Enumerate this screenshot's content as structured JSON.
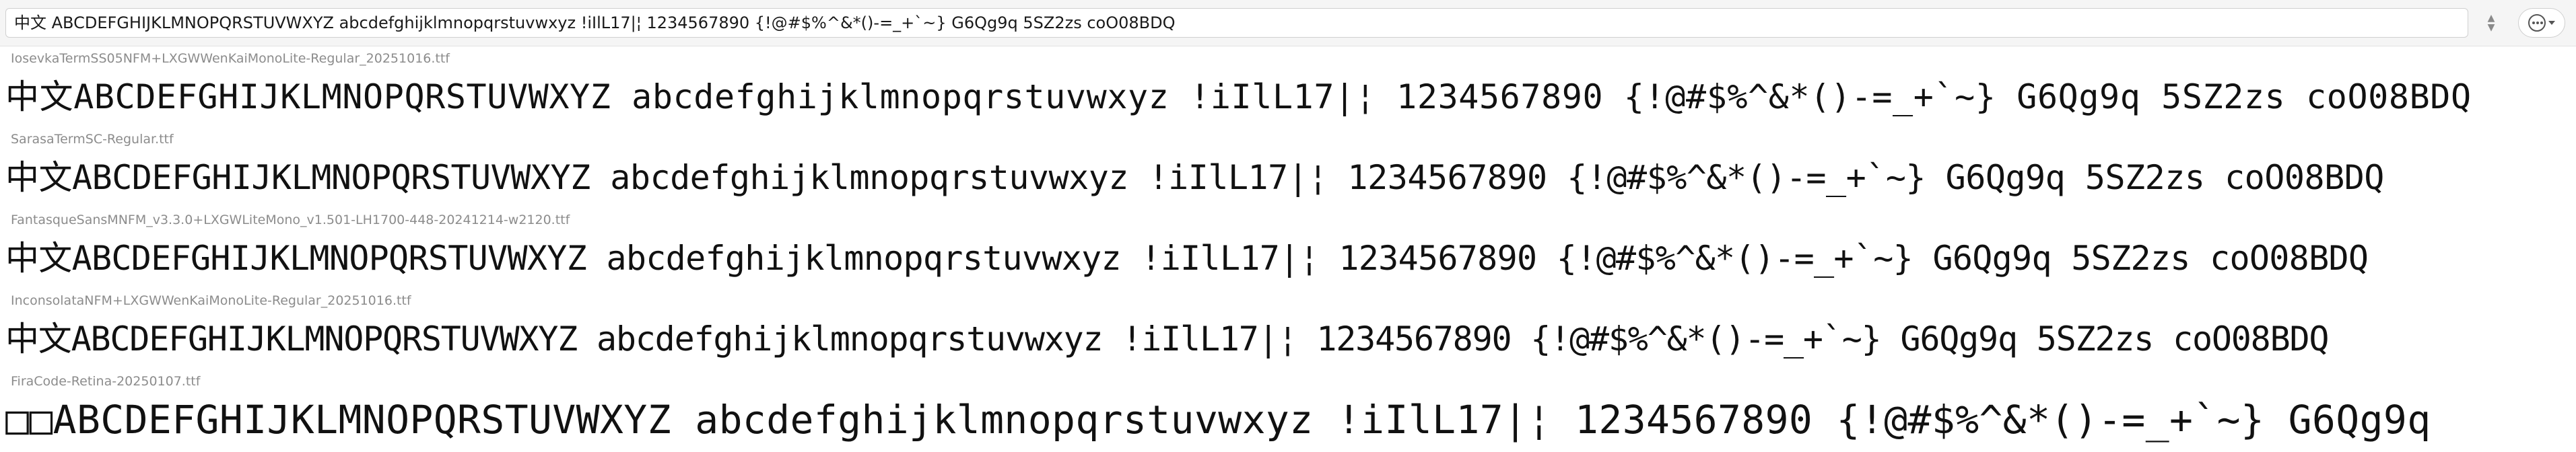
{
  "toolbar": {
    "sample_text": "中文 ABCDEFGHIJKLMNOPQRSTUVWXYZ abcdefghijklmnopqrstuvwxyz !iIlL17|¦ 1234567890 {!@#$%^&*()-=_+`~} G6Qg9q 5SZ2zs coO08BDQ",
    "stepper_up_icon": "chevron-up-icon",
    "stepper_down_icon": "chevron-down-icon",
    "more_icon": "ellipsis-circle-icon"
  },
  "fonts": [
    {
      "name": "IosevkaTermSS05NFM+LXGWWenKaiMonoLite-Regular_20251016.ttf",
      "preview": "中文ABCDEFGHIJKLMNOPQRSTUVWXYZ abcdefghijklmnopqrstuvwxyz !iIlL17|¦ 1234567890 {!@#$%^&*()-=_+`~} G6Qg9q 5SZ2zs coO08BDQ"
    },
    {
      "name": "SarasaTermSC-Regular.ttf",
      "preview": "中文ABCDEFGHIJKLMNOPQRSTUVWXYZ abcdefghijklmnopqrstuvwxyz !iIlL17|¦ 1234567890 {!@#$%^&*()-=_+`~} G6Qg9q 5SZ2zs coO08BDQ"
    },
    {
      "name": "FantasqueSansMNFM_v3.3.0+LXGWLiteMono_v1.501-LH1700-448-20241214-w2120.ttf",
      "preview": "中文ABCDEFGHIJKLMNOPQRSTUVWXYZ abcdefghijklmnopqrstuvwxyz !iIlL17|¦ 1234567890 {!@#$%^&*()-=_+`~} G6Qg9q 5SZ2zs coO08BDQ"
    },
    {
      "name": "InconsolataNFM+LXGWWenKaiMonoLite-Regular_20251016.ttf",
      "preview": "中文ABCDEFGHIJKLMNOPQRSTUVWXYZ abcdefghijklmnopqrstuvwxyz !iIlL17|¦ 1234567890 {!@#$%^&*()-=_+`~} G6Qg9q 5SZ2zs coO08BDQ"
    },
    {
      "name": "FiraCode-Retina-20250107.ttf",
      "preview": "□□ABCDEFGHIJKLMNOPQRSTUVWXYZ abcdefghijklmnopqrstuvwxyz !iIlL17|¦ 1234567890 {!@#$%^&*()-=_+`~} G6Qg9q"
    }
  ]
}
